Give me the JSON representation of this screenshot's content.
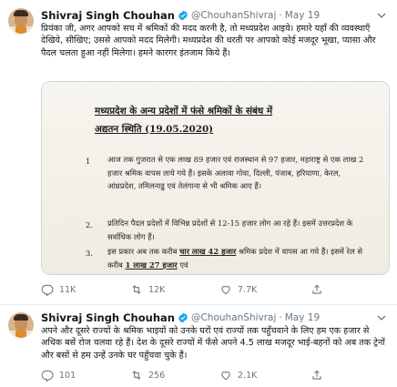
{
  "tweets": [
    {
      "name": "Shivraj Singh Chouhan",
      "handle": "@ChouhanShivraj",
      "dot": "·",
      "date": "May 19",
      "text": "प्रियंका जी, अगर आपको सच में श्रमिकों की मदद करनी है, तो मध्यप्रदेश आइये। हमारे यहाँ की व्यवस्थाएँ देखिये, सीखिए; उससे आपको मदद मिलेगी। मध्यप्रदेश की धरती पर आपको कोई मजदूर भूखा, प्यासा और पैदल चलता हुआ नहीं मिलेगा। हमने कारगर इंतजाम किये हैं।",
      "media": {
        "title_line1": "मध्यप्रदेश के अन्य प्रदेशों में फंसे श्रमिकों के संबंध में",
        "title_line2": "अद्यतन स्थिति (19.05.2020)",
        "items": [
          {
            "num": "1",
            "text": "आज तक गुजरात से एक लाख 89 हजार एवं राजस्थान से 97 हजार, महाराष्ट्र से एक लाख 2 हजार श्रमिक वापस लाये गये हैं। इसके अलावा गोवा, दिल्ली, पंजाब, हरियाणा, केरल, आंध्रप्रदेश, तमिलनाडु एवं तेलंगाना से भी श्रमिक आए हैं।"
          },
          {
            "num": "2.",
            "text": "प्रतिदिन पैदल प्रदेशों में विभिन्न प्रदेशों से 12-15 हजार लोग आ रहे हैं। इसमें उत्तरप्रदेश के सर्वाधिक लोग हैं।"
          },
          {
            "num": "3.",
            "text_a": "इस प्रकार अब तक करीब ",
            "highlight_1": "चार लाख 42 हजार",
            "text_b": " श्रमिक प्रदेश में वापस आ गये हैं। इसमें रेल से करीब ",
            "highlight_2": "1 लाख 27 हजार",
            "text_c": " एवं"
          }
        ]
      },
      "replies": "11K",
      "retweets": "12K",
      "likes": "7.7K"
    },
    {
      "name": "Shivraj Singh Chouhan",
      "handle": "@ChouhanShivraj",
      "dot": "·",
      "date": "May 19",
      "text": "अपने और दूसरे राज्यों के श्रमिक भाइयों को उनके घरों एवं राज्यों तक पहुँचवाने के लिए हम एक हजार से अधिक बसें रोज चलवा रहे हैं। देश के दूसरे राज्यों में फँसे अपने 4.5 लाख मजदूर भाई-बहनों को अब तक ट्रेनों और बसों से हम उन्हें उनके घर पहुँचवा चुके हैं।",
      "replies": "101",
      "retweets": "256",
      "likes": "2.1K"
    }
  ],
  "colors": {
    "verified": "#1da1f2",
    "muted": "#657786",
    "border": "#e6ecf0"
  },
  "icons": [
    "verified-badge-icon",
    "chevron-down-icon",
    "reply-icon",
    "retweet-icon",
    "like-icon",
    "share-icon"
  ]
}
